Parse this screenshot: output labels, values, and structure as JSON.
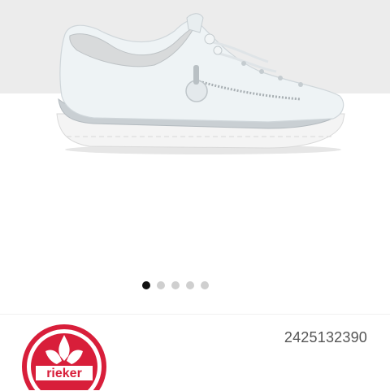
{
  "gallery": {
    "image_subject": "white-slip-on-sneaker",
    "dot_count": 5,
    "active_index": 0,
    "colors": {
      "active_dot": "#111111",
      "inactive_dot": "#cfcfcf"
    }
  },
  "product": {
    "sku": "2425132390",
    "brand_logo_text": "rieker",
    "brand_color": "#d81e3a"
  }
}
